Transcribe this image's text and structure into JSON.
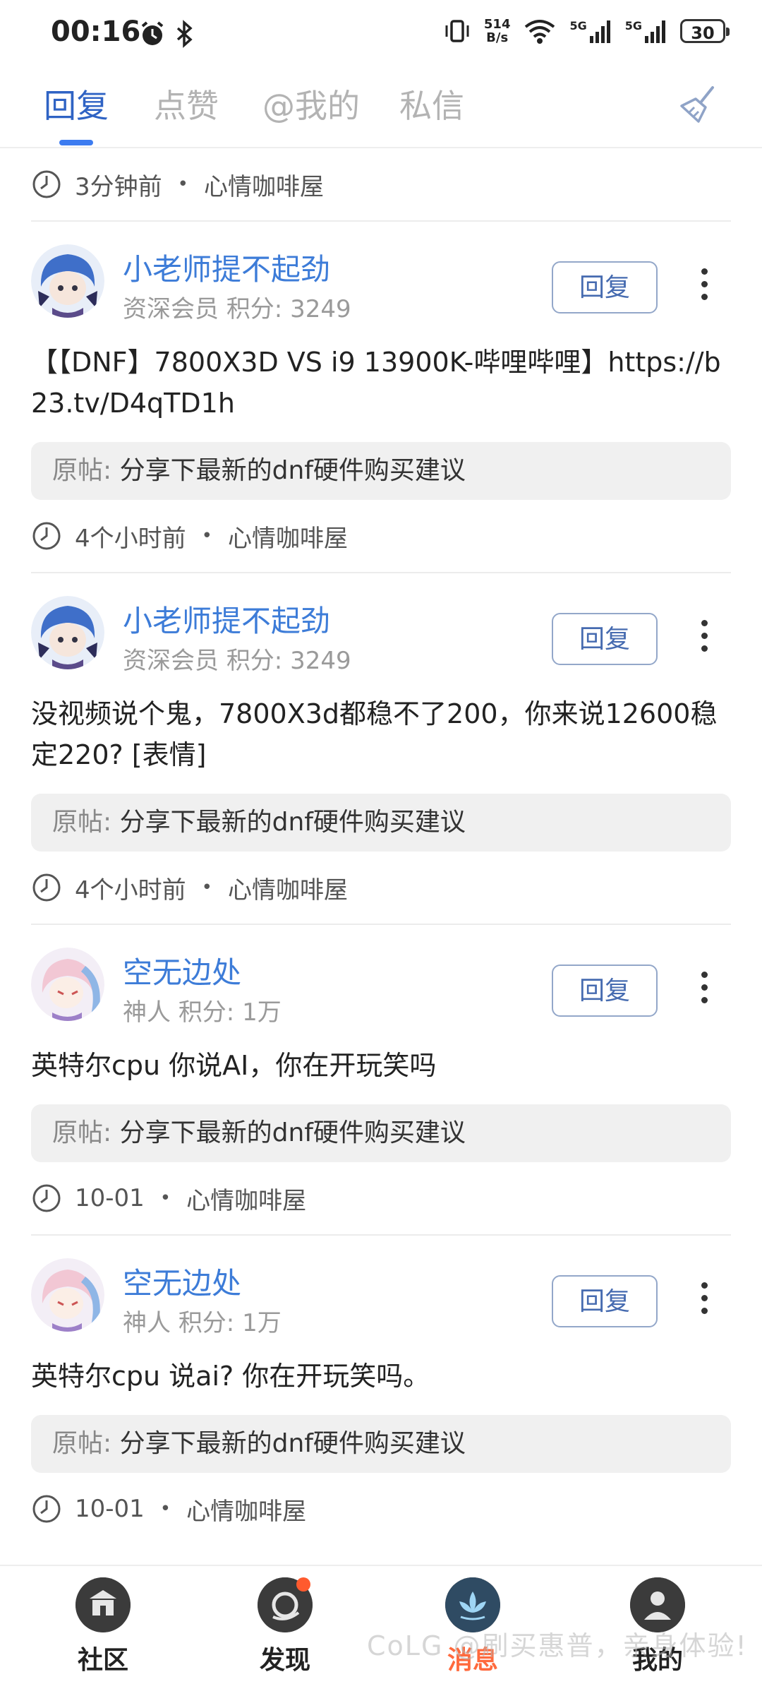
{
  "status_bar": {
    "time": "00:16",
    "net_speed_top": "514",
    "net_speed_bottom": "B/s",
    "sig1": "5G",
    "sig2": "5G",
    "battery": "30"
  },
  "tabs": [
    {
      "label": "回复"
    },
    {
      "label": "点赞"
    },
    {
      "label": "@我的"
    },
    {
      "label": "私信"
    }
  ],
  "top_meta": {
    "time": "3分钟前",
    "board": "心情咖啡屋"
  },
  "items": [
    {
      "username": "小老师提不起劲",
      "rank": "资深会员",
      "score": "积分: 3249",
      "reply_label": "回复",
      "content": "【【DNF】7800X3D VS i9 13900K-哔哩哔哩】https://b23.tv/D4qTD1h",
      "origin_prefix": "原帖:",
      "origin_title": "分享下最新的dnf硬件购买建议",
      "time": "4个小时前",
      "board": "心情咖啡屋"
    },
    {
      "username": "小老师提不起劲",
      "rank": "资深会员",
      "score": "积分: 3249",
      "reply_label": "回复",
      "content": "没视频说个鬼，7800X3d都稳不了200，你来说12600稳定220? [表情]",
      "origin_prefix": "原帖:",
      "origin_title": "分享下最新的dnf硬件购买建议",
      "time": "4个小时前",
      "board": "心情咖啡屋"
    },
    {
      "username": "空无边处",
      "rank": "神人",
      "score": "积分: 1万",
      "reply_label": "回复",
      "content": "英特尔cpu 你说AI，你在开玩笑吗",
      "origin_prefix": "原帖:",
      "origin_title": "分享下最新的dnf硬件购买建议",
      "time": "10-01",
      "board": "心情咖啡屋"
    },
    {
      "username": "空无边处",
      "rank": "神人",
      "score": "积分: 1万",
      "reply_label": "回复",
      "content": "英特尔cpu 说ai? 你在开玩笑吗。",
      "origin_prefix": "原帖:",
      "origin_title": "分享下最新的dnf硬件购买建议",
      "time": "10-01",
      "board": "心情咖啡屋"
    }
  ],
  "bottom_nav": [
    {
      "label": "社区"
    },
    {
      "label": "发现"
    },
    {
      "label": "消息"
    },
    {
      "label": "我的"
    }
  ],
  "watermark": "CoLG @刷买惠普，亲身体验!",
  "colors": {
    "accent": "#3d7cf0",
    "username": "#3d7cd8",
    "active_nav": "#ff6a3d",
    "badge": "#ff5a2e"
  }
}
